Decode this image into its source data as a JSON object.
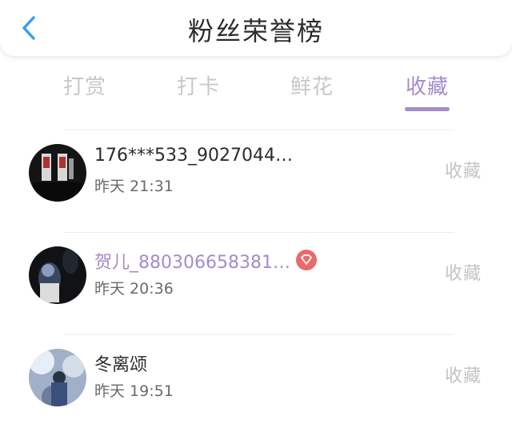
{
  "header": {
    "title": "粉丝荣誉榜",
    "back_icon": "chevron-left-icon",
    "accent": "#3aa0e8"
  },
  "tabs": [
    {
      "label": "打赏",
      "active": false
    },
    {
      "label": "打卡",
      "active": false
    },
    {
      "label": "鲜花",
      "active": false
    },
    {
      "label": "收藏",
      "active": true
    }
  ],
  "colors": {
    "accent": "#a58bcb",
    "inactive_tab": "#c8c8cc",
    "badge": "#e96a6a"
  },
  "list": [
    {
      "name": "176***533_9027044…",
      "time": "昨天 21:31",
      "action": "收藏",
      "vip": false
    },
    {
      "name": "贺儿_880306658381…",
      "time": "昨天 20:36",
      "action": "收藏",
      "vip": true,
      "badge_icon": "diamond-icon"
    },
    {
      "name": "冬离颂",
      "time": "昨天 19:51",
      "action": "收藏",
      "vip": false
    }
  ]
}
